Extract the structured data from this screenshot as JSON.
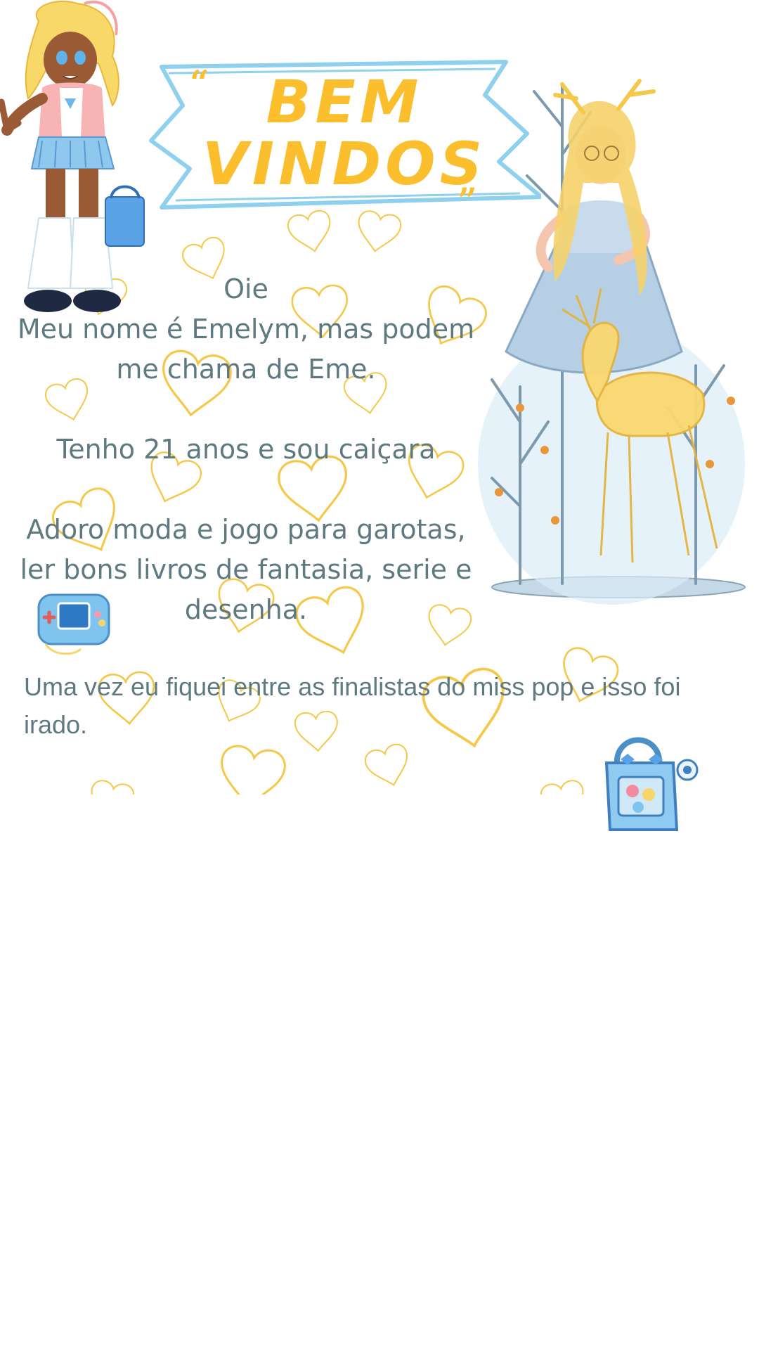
{
  "banner": {
    "line1": "BEM",
    "line2": "VINDOS",
    "quote_open": "“",
    "quote_close": "„"
  },
  "intro": {
    "line_greeting": "Oie",
    "line_name": "Meu nome é Emelym, mas podem me chama de Eme.",
    "line_age": "Tenho 21 anos e sou caiçara",
    "line_hobbies": "Adoro moda e jogo para garotas, ler bons livros de fantasia, serie e desenha."
  },
  "extra": {
    "text": "Uma vez eu fiquei entre as finalistas do miss pop e isso foi irado."
  },
  "colors": {
    "accent_yellow": "#fbbf2e",
    "banner_blue": "#8fd0ee",
    "text_teal": "#5e7a80",
    "heart_outline": "#f5c84a"
  },
  "icons": {
    "girl": "anime-girl-character-illustration",
    "fairy": "fairy-with-golden-deer-illustration",
    "handheld": "handheld-game-console-icon",
    "bag": "blue-handbag-icon",
    "hearts": "heart-outline-pattern"
  }
}
